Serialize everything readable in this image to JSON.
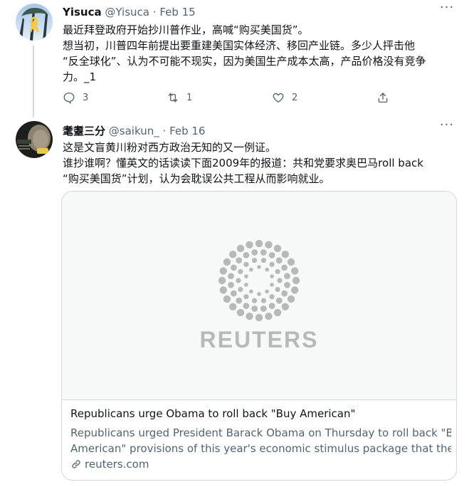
{
  "tweets": [
    {
      "name": "Yisuca",
      "handle": "@Yisuca",
      "separator": "·",
      "date": "Feb 15",
      "more_icon": "more-horizontal-icon",
      "lines": [
        "最近拜登政府开始抄川普作业，高喊“购买美国货”。",
        "想当初，川普四年前提出要重建美国实体经济、移回产业链。多少人抨击他",
        "“反全球化”、认为不可能不现实，因为美国生产成本太高，产品价格没有竞争",
        "力。_1"
      ],
      "actions": {
        "reply_count": "3",
        "retweet_count": "1",
        "like_count": "2",
        "share_count": ""
      }
    },
    {
      "name": "耄耋三分",
      "handle": "@saikun_",
      "separator": "·",
      "date": "Feb 16",
      "more_icon": "more-horizontal-icon",
      "lines": [
        "这是文盲黄川粉对西方政治无知的又一例证。",
        "谁抄谁啊？懂英文的话读读下面2009年的报道：共和党要求奥巴马roll back",
        "“购买美国货”计划，认为会耽误公共工程从而影响就业。"
      ],
      "card": {
        "logo_text": "REUTERS",
        "title": "Republicans urge Obama to roll back \"Buy American\"",
        "description_lines": [
          "Republicans urged President Barack Obama on Thursday to roll back \"Buy",
          "American\" provisions of this year's economic stimulus package that the..."
        ],
        "domain": "reuters.com"
      }
    }
  ],
  "colors": {
    "text": "#0f1419",
    "secondary": "#536471",
    "border": "#cfd9de",
    "card_media_bg": "#f7f9f9",
    "reuters_logo": "#b8b8b8"
  }
}
